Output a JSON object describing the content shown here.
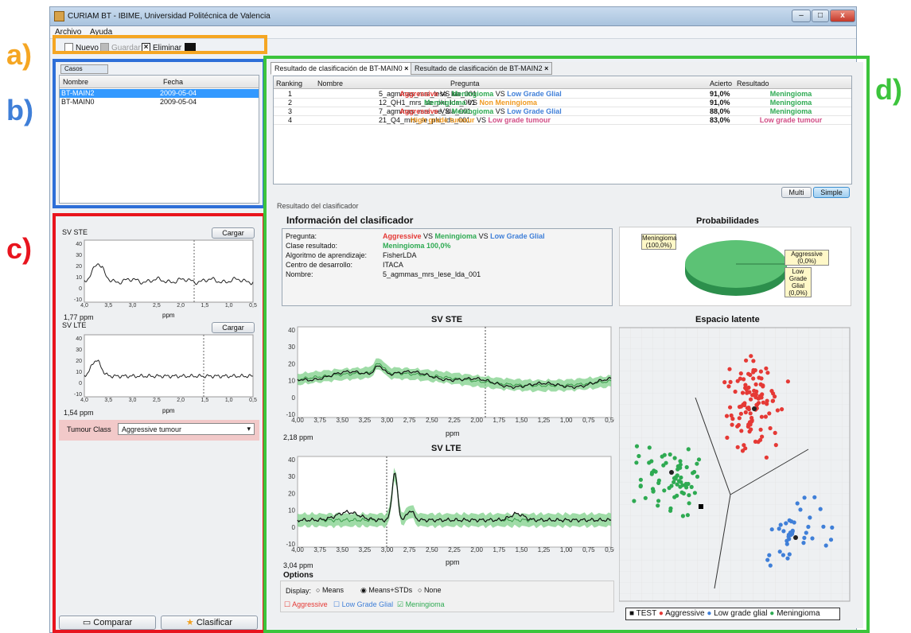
{
  "window": {
    "title": "CURIAM BT - IBIME, Universidad Politécnica de Valencia",
    "min": "–",
    "max": "□",
    "close": "x"
  },
  "menu": [
    "Archivo",
    "Ayuda"
  ],
  "toolbar": {
    "new_label": "Nuevo",
    "save_label": "Guardar",
    "delete_label": "Eliminar"
  },
  "annotations": {
    "a": "a)",
    "b": "b)",
    "c": "c)",
    "d": "d)"
  },
  "cases": {
    "tab_label": "Casos",
    "headers": [
      "Nombre",
      "Fecha"
    ],
    "rows": [
      {
        "name": "BT-MAIN2",
        "date": "2009-05-04",
        "selected": true
      },
      {
        "name": "BT-MAIN0",
        "date": "2009-05-04",
        "selected": false
      }
    ]
  },
  "spectra": {
    "ste": {
      "title": "SV STE",
      "load_label": "Cargar",
      "ppm_label": "1,77 ppm",
      "xunit": "ppm",
      "xticks": [
        "4,0",
        "3,5",
        "3,0",
        "2,5",
        "2,0",
        "1,5",
        "1,0",
        "0,5"
      ],
      "yticks": [
        "40",
        "30",
        "20",
        "10",
        "0",
        "-10"
      ]
    },
    "lte": {
      "title": "SV LTE",
      "load_label": "Cargar",
      "ppm_label": "1,54 ppm",
      "xunit": "ppm",
      "xticks": [
        "4,0",
        "3,5",
        "3,0",
        "2,5",
        "2,0",
        "1,5",
        "1,0",
        "0,5"
      ],
      "yticks": [
        "40",
        "30",
        "20",
        "10",
        "0",
        "-10"
      ]
    },
    "tumour_class_label": "Tumour Class",
    "tumour_class_value": "Aggressive tumour"
  },
  "bottom_buttons": {
    "compare": "Comparar",
    "classify": "Clasificar"
  },
  "result_tabs": [
    "Resultado de clasificación de BT-MAIN0",
    "Resultado de clasificación de BT-MAIN2"
  ],
  "ranking": {
    "headers": [
      "Ranking",
      "Nombre",
      "Pregunta",
      "Acierto",
      "Resultado"
    ],
    "rows": [
      {
        "rank": "1",
        "name": "5_agmmas_mrs_lese_lda_001",
        "q": [
          [
            "Aggressive",
            "red"
          ],
          [
            " VS ",
            ""
          ],
          [
            "Meningioma",
            "green"
          ],
          [
            " VS ",
            ""
          ],
          [
            "Low Grade Glial",
            "blue"
          ]
        ],
        "acc": "91,0%",
        "res": "Meningioma",
        "res_color": "green"
      },
      {
        "rank": "2",
        "name": "12_QH1_mrs_se_pki_lda_001",
        "q": [
          [
            "Meningioma",
            "green"
          ],
          [
            " VS ",
            ""
          ],
          [
            "Non Meningioma",
            "orange"
          ]
        ],
        "acc": "91,0%",
        "res": "Meningioma",
        "res_color": "green"
      },
      {
        "rank": "3",
        "name": "7_agmmas_mrs_se_lda_001",
        "q": [
          [
            "Aggressive",
            "red"
          ],
          [
            " VS ",
            ""
          ],
          [
            "Meningioma",
            "green"
          ],
          [
            " VS ",
            ""
          ],
          [
            "Low Grade Glial",
            "blue"
          ]
        ],
        "acc": "88,0%",
        "res": "Meningioma",
        "res_color": "green"
      },
      {
        "rank": "4",
        "name": "21_Q4_mrs_se_pki_lda_001",
        "q": [
          [
            "High grade tumour",
            "orange"
          ],
          [
            " VS ",
            ""
          ],
          [
            "Low grade tumour",
            "pink"
          ]
        ],
        "acc": "83,0%",
        "res": "Low grade tumour",
        "res_color": "pink"
      }
    ]
  },
  "mode_buttons": {
    "multi": "Multi",
    "simple": "Simple"
  },
  "result_section_title": "Resultado del clasificador",
  "info": {
    "title": "Información del clasificador",
    "question_label": "Pregunta:",
    "class_label": "Clase resultado:",
    "class_value": "Meningioma 100,0%",
    "algo_label": "Algoritmo de aprendizaje:",
    "algo_value": "FisherLDA",
    "center_label": "Centro de desarrollo:",
    "center_value": "ITACA",
    "name_label": "Nombre:",
    "name_value": "5_agmmas_mrs_lese_lda_001"
  },
  "prob": {
    "title": "Probabilidades",
    "men": "Meningioma (100,0%)",
    "agg": "Aggressive (0,0%)",
    "lgg": "Low Grade Glial (0,0%)"
  },
  "big_ste": {
    "title": "SV STE",
    "ppm_label": "2,18 ppm",
    "xunit": "ppm",
    "xticks": [
      "4,00",
      "3,75",
      "3,50",
      "3,25",
      "3,00",
      "2,75",
      "2,50",
      "2,25",
      "2,00",
      "1,75",
      "1,50",
      "1,25",
      "1,00",
      "0,75",
      "0,50"
    ],
    "yticks": [
      "40",
      "30",
      "20",
      "10",
      "0",
      "-10"
    ]
  },
  "big_lte": {
    "title": "SV LTE",
    "ppm_label": "3,04 ppm",
    "xunit": "ppm",
    "xticks": [
      "4,00",
      "3,75",
      "3,50",
      "3,25",
      "3,00",
      "2,75",
      "2,50",
      "2,25",
      "2,00",
      "1,75",
      "1,50",
      "1,25",
      "1,00",
      "0,75",
      "0,50"
    ],
    "yticks": [
      "40",
      "30",
      "20",
      "10",
      "0",
      "-10"
    ]
  },
  "latent": {
    "title": "Espacio latente",
    "legend": [
      "TEST",
      "Aggressive",
      "Low grade glial",
      "Meningioma"
    ]
  },
  "options": {
    "title": "Options",
    "display_label": "Display:",
    "radios": [
      {
        "label": "Means",
        "checked": false
      },
      {
        "label": "Means+STDs",
        "checked": true
      },
      {
        "label": "None",
        "checked": false
      }
    ],
    "checks": [
      {
        "label": "Aggressive",
        "checked": false,
        "color": "#e53935"
      },
      {
        "label": "Low Grade Glial",
        "checked": false,
        "color": "#3f7fd8"
      },
      {
        "label": "Meningioma",
        "checked": true,
        "color": "#2eaa52"
      }
    ]
  },
  "colors": {
    "frame_a": "#f5a623",
    "frame_b": "#2e6fd8",
    "frame_c": "#e8141e",
    "frame_d": "#3cc43c",
    "aggressive": "#e53935",
    "lgg": "#3f7fd8",
    "meningioma": "#2eaa52"
  }
}
